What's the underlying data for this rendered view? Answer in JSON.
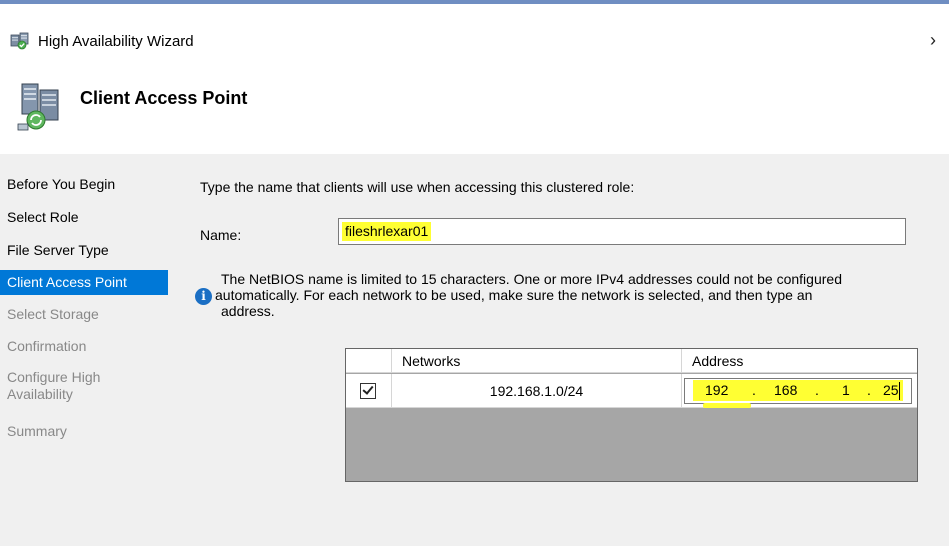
{
  "window": {
    "title": "High Availability Wizard",
    "title_icon": "cluster-wizard-icon",
    "close_glyph": "›",
    "accent_color": "#0078d7"
  },
  "header": {
    "title": "Client Access Point",
    "icon": "server-cluster-icon"
  },
  "sidebar": {
    "items": [
      {
        "label": "Before You Begin",
        "state": "done"
      },
      {
        "label": "Select Role",
        "state": "done"
      },
      {
        "label": "File Server Type",
        "state": "done"
      },
      {
        "label": "Client Access Point",
        "state": "current"
      },
      {
        "label": "Select Storage",
        "state": "pending"
      },
      {
        "label": "Confirmation",
        "state": "pending"
      },
      {
        "label": "Configure High Availability",
        "state": "pending"
      },
      {
        "label": "Summary",
        "state": "pending"
      }
    ]
  },
  "main": {
    "instruction": "Type the name that clients will use when accessing this clustered role:",
    "name_label": "Name:",
    "name_value": "fileshrlexar01",
    "info_icon": "info-icon",
    "info_lines": [
      "The NetBIOS name is limited to 15 characters.  One or more IPv4 addresses could not be configured",
      "automatically.  For each network to be used, make sure the network is selected, and then type an",
      "address."
    ],
    "grid": {
      "columns": [
        "",
        "Networks",
        "Address"
      ],
      "rows": [
        {
          "checked": true,
          "network": "192.168.1.0/24",
          "address": [
            "192",
            "168",
            "1",
            "25"
          ]
        }
      ]
    },
    "highlight_color": "#ffff33"
  }
}
